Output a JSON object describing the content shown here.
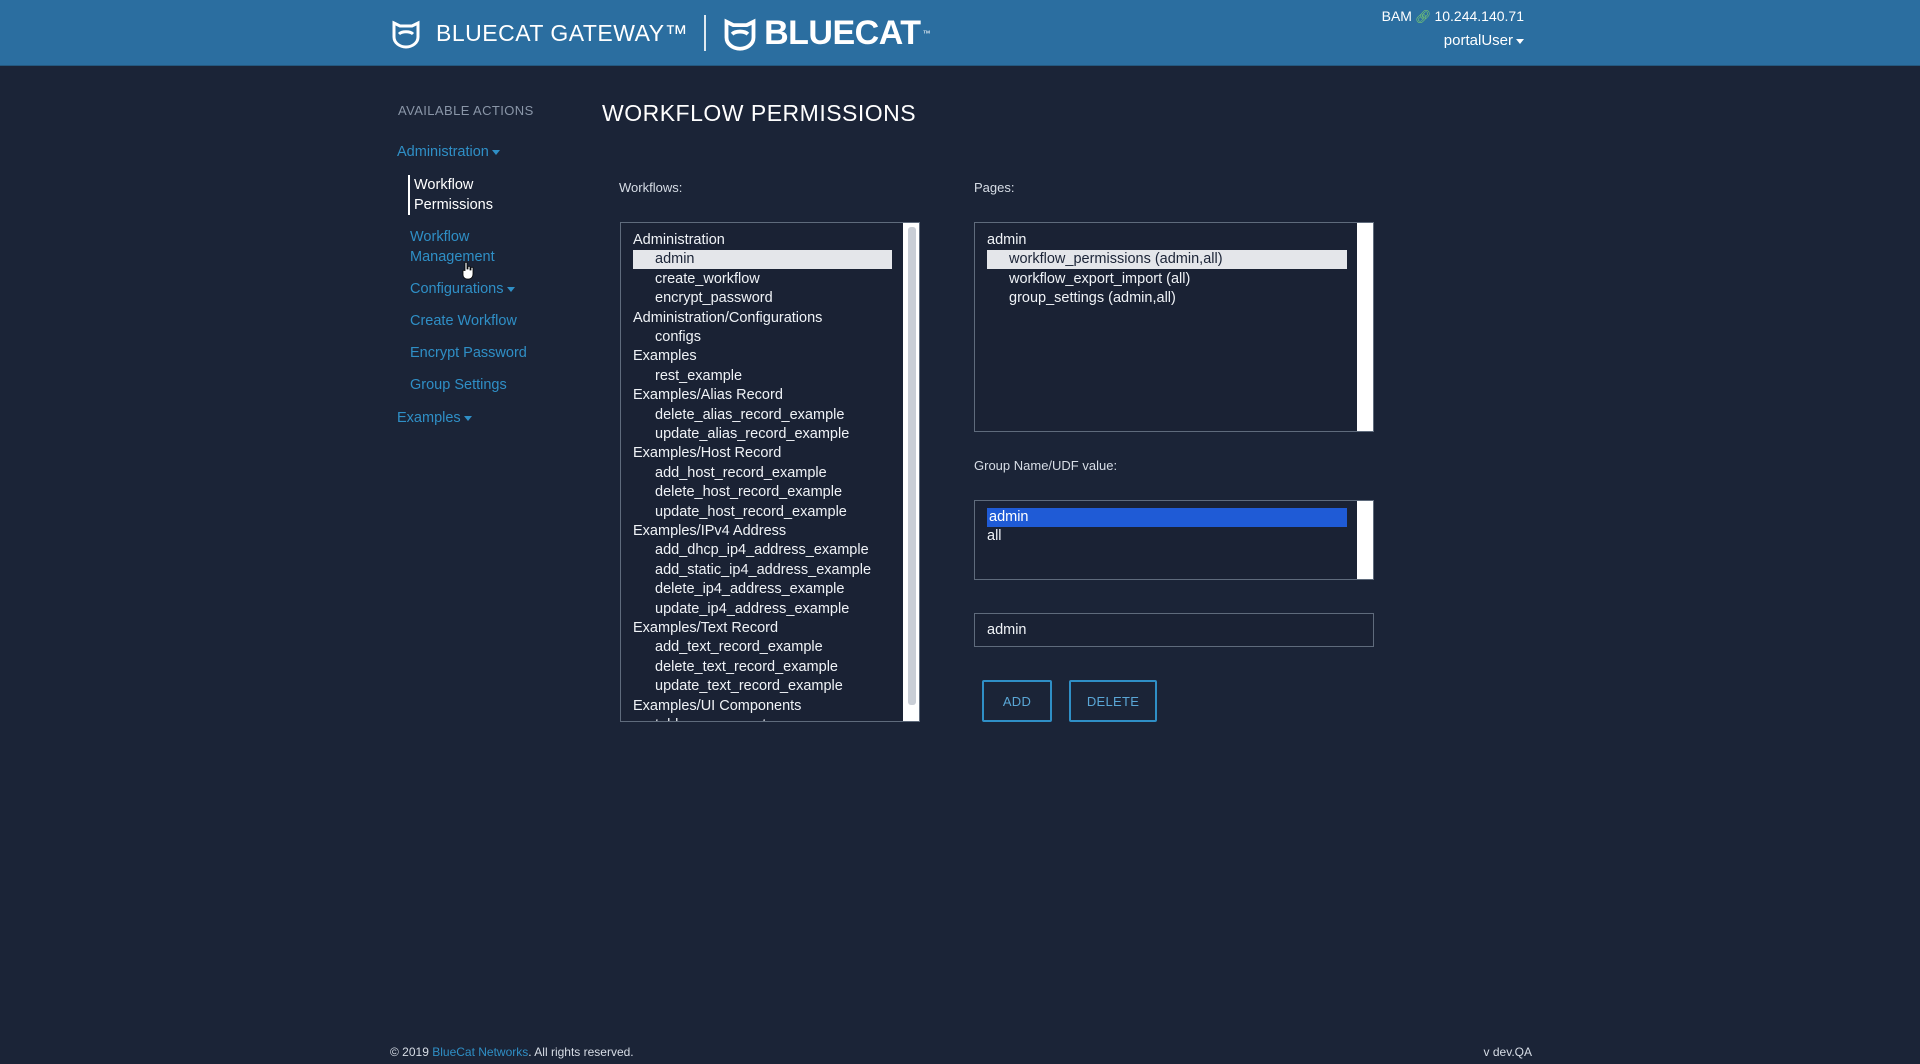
{
  "header": {
    "product_name": "BLUECAT GATEWAY™",
    "logo_text": "BLUECAT",
    "logo_tm": "™",
    "server_label": "BAM",
    "server_ip": "10.244.140.71",
    "user_menu": "portalUser"
  },
  "sidebar": {
    "heading": "AVAILABLE ACTIONS",
    "administration": "Administration",
    "workflow_permissions": [
      "Workflow",
      "Permissions"
    ],
    "workflow_management": [
      "Workflow",
      "Management"
    ],
    "configurations": "Configurations",
    "create_workflow": "Create Workflow",
    "encrypt_password": "Encrypt Password",
    "group_settings": "Group Settings",
    "examples": "Examples"
  },
  "main": {
    "title": "WORKFLOW PERMISSIONS",
    "workflows_label": "Workflows:",
    "pages_label": "Pages:",
    "group_label": "Group Name/UDF value:",
    "workflows": [
      {
        "text": "Administration",
        "child": false,
        "selected": false
      },
      {
        "text": "admin",
        "child": true,
        "selected": true
      },
      {
        "text": "create_workflow",
        "child": true,
        "selected": false
      },
      {
        "text": "encrypt_password",
        "child": true,
        "selected": false
      },
      {
        "text": "Administration/Configurations",
        "child": false,
        "selected": false
      },
      {
        "text": "configs",
        "child": true,
        "selected": false
      },
      {
        "text": "Examples",
        "child": false,
        "selected": false
      },
      {
        "text": "rest_example",
        "child": true,
        "selected": false
      },
      {
        "text": "Examples/Alias Record",
        "child": false,
        "selected": false
      },
      {
        "text": "delete_alias_record_example",
        "child": true,
        "selected": false
      },
      {
        "text": "update_alias_record_example",
        "child": true,
        "selected": false
      },
      {
        "text": "Examples/Host Record",
        "child": false,
        "selected": false
      },
      {
        "text": "add_host_record_example",
        "child": true,
        "selected": false
      },
      {
        "text": "delete_host_record_example",
        "child": true,
        "selected": false
      },
      {
        "text": "update_host_record_example",
        "child": true,
        "selected": false
      },
      {
        "text": "Examples/IPv4 Address",
        "child": false,
        "selected": false
      },
      {
        "text": "add_dhcp_ip4_address_example",
        "child": true,
        "selected": false
      },
      {
        "text": "add_static_ip4_address_example",
        "child": true,
        "selected": false
      },
      {
        "text": "delete_ip4_address_example",
        "child": true,
        "selected": false
      },
      {
        "text": "update_ip4_address_example",
        "child": true,
        "selected": false
      },
      {
        "text": "Examples/Text Record",
        "child": false,
        "selected": false
      },
      {
        "text": "add_text_record_example",
        "child": true,
        "selected": false
      },
      {
        "text": "delete_text_record_example",
        "child": true,
        "selected": false
      },
      {
        "text": "update_text_record_example",
        "child": true,
        "selected": false
      },
      {
        "text": "Examples/UI Components",
        "child": false,
        "selected": false
      },
      {
        "text": "table_component",
        "child": true,
        "selected": false
      }
    ],
    "pages": [
      {
        "text": "admin",
        "child": false,
        "selected": false
      },
      {
        "text": "workflow_permissions (admin,all)",
        "child": true,
        "selected": true
      },
      {
        "text": "workflow_export_import (all)",
        "child": true,
        "selected": false
      },
      {
        "text": "group_settings (admin,all)",
        "child": true,
        "selected": false
      }
    ],
    "groups": [
      {
        "text": "admin",
        "selected": true
      },
      {
        "text": "all",
        "selected": false
      }
    ],
    "group_input_value": "admin",
    "add_label": "ADD",
    "delete_label": "DELETE"
  },
  "footer": {
    "copyright": "© 2019",
    "company": "BlueCat Networks",
    "rights": ". All rights reserved.",
    "version": "v dev.QA"
  },
  "colors": {
    "header_bg": "#2b6ea0",
    "page_bg": "#1b2437",
    "link": "#2f8fc6",
    "selection_blue": "#1f5bd6"
  }
}
